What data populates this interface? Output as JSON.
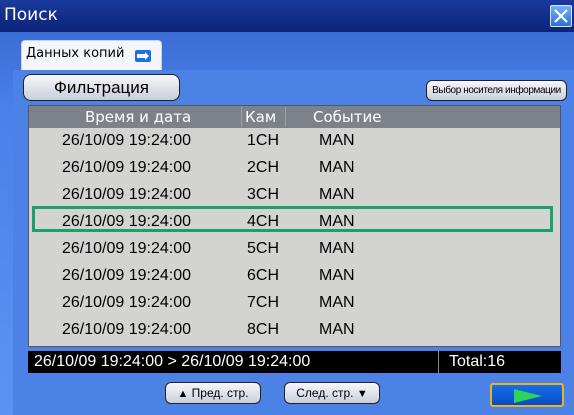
{
  "window": {
    "title": "Поиск"
  },
  "tab": {
    "label": "Данных копий"
  },
  "toolbar": {
    "filter_label": "Фильтрация",
    "media_label": "Выбор носителя информации"
  },
  "table": {
    "headers": {
      "datetime": "Время и дата",
      "cam": "Кам",
      "event": "Событие"
    },
    "rows": [
      {
        "datetime": "26/10/09 19:24:00",
        "cam": "1CH",
        "event": "MAN"
      },
      {
        "datetime": "26/10/09 19:24:00",
        "cam": "2CH",
        "event": "MAN"
      },
      {
        "datetime": "26/10/09 19:24:00",
        "cam": "3CH",
        "event": "MAN"
      },
      {
        "datetime": "26/10/09 19:24:00",
        "cam": "4CH",
        "event": "MAN"
      },
      {
        "datetime": "26/10/09 19:24:00",
        "cam": "5CH",
        "event": "MAN"
      },
      {
        "datetime": "26/10/09 19:24:00",
        "cam": "6CH",
        "event": "MAN"
      },
      {
        "datetime": "26/10/09 19:24:00",
        "cam": "7CH",
        "event": "MAN"
      },
      {
        "datetime": "26/10/09 19:24:00",
        "cam": "8CH",
        "event": "MAN"
      }
    ],
    "selected_row": 3
  },
  "range": {
    "text": "26/10/09 19:24:00 > 26/10/09 19:24:00",
    "total": "Total:16"
  },
  "nav": {
    "prev_label": "Пред. стр.",
    "next_label": "След. стр.",
    "prev_icon": "up-triangle-icon",
    "next_icon": "down-triangle-icon",
    "play_icon": "play-icon"
  },
  "colors": {
    "title_bar": "#0c2378",
    "panel": "#4c82e6",
    "selection": "#1ca06a",
    "play_border": "#f0b020",
    "play_arrow": "#2fd25a"
  }
}
